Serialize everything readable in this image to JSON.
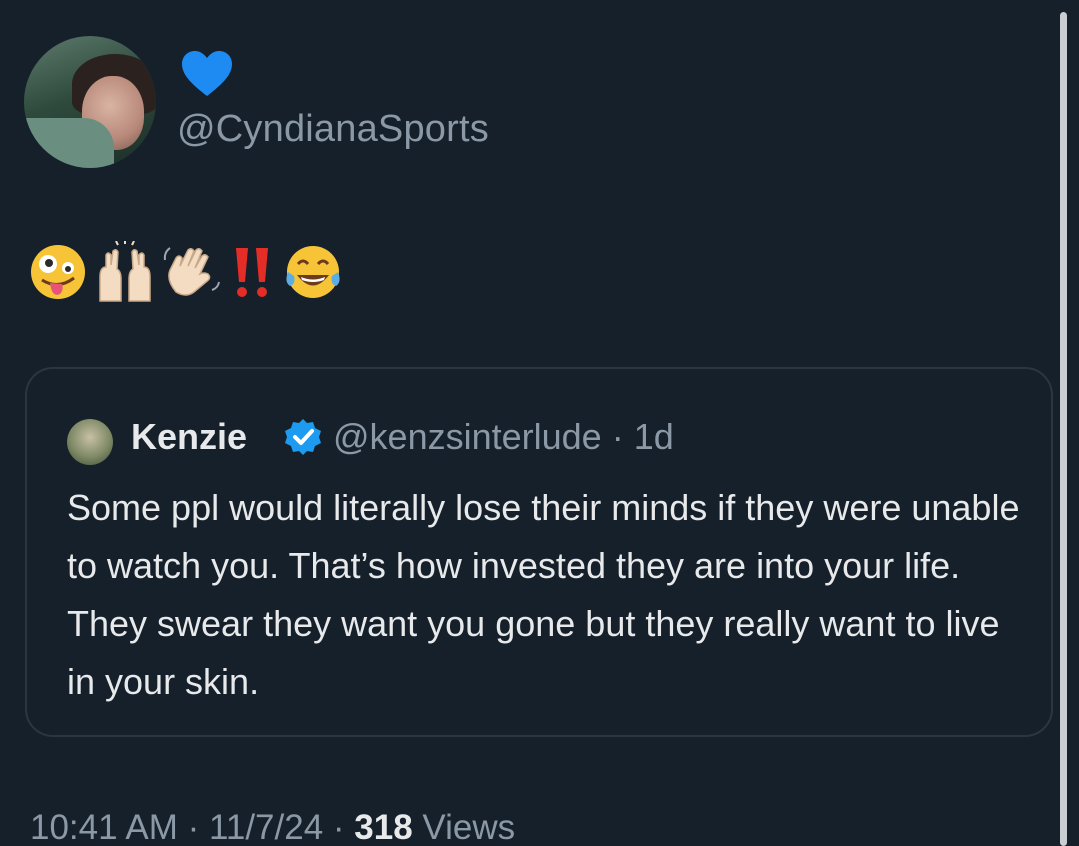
{
  "tweet": {
    "display_name_emoji": "💙",
    "handle": "@CyndianaSports",
    "emoji_icons": [
      "zany-face-icon",
      "raising-hands-icon",
      "waving-hand-icon",
      "double-exclamation-icon",
      "tears-of-joy-icon"
    ],
    "quote": {
      "name": "Kenzie",
      "handle": "@kenzsinterlude",
      "separator": " · ",
      "age": "1d",
      "text": "Some ppl would literally lose their minds if they were unable to watch you. That’s how invested they are into your life. They swear they want you gone but they really want to live in your skin."
    },
    "footer": {
      "time": "10:41 AM",
      "sep1": " · ",
      "date": "11/7/24",
      "sep2": " · ",
      "views_count": "318",
      "views_label": " Views"
    }
  },
  "colors": {
    "background": "#15202b",
    "text": "#e7e9ea",
    "muted": "#8b98a5",
    "verified": "#1d9bf0",
    "heart": "#1d8bf1"
  }
}
